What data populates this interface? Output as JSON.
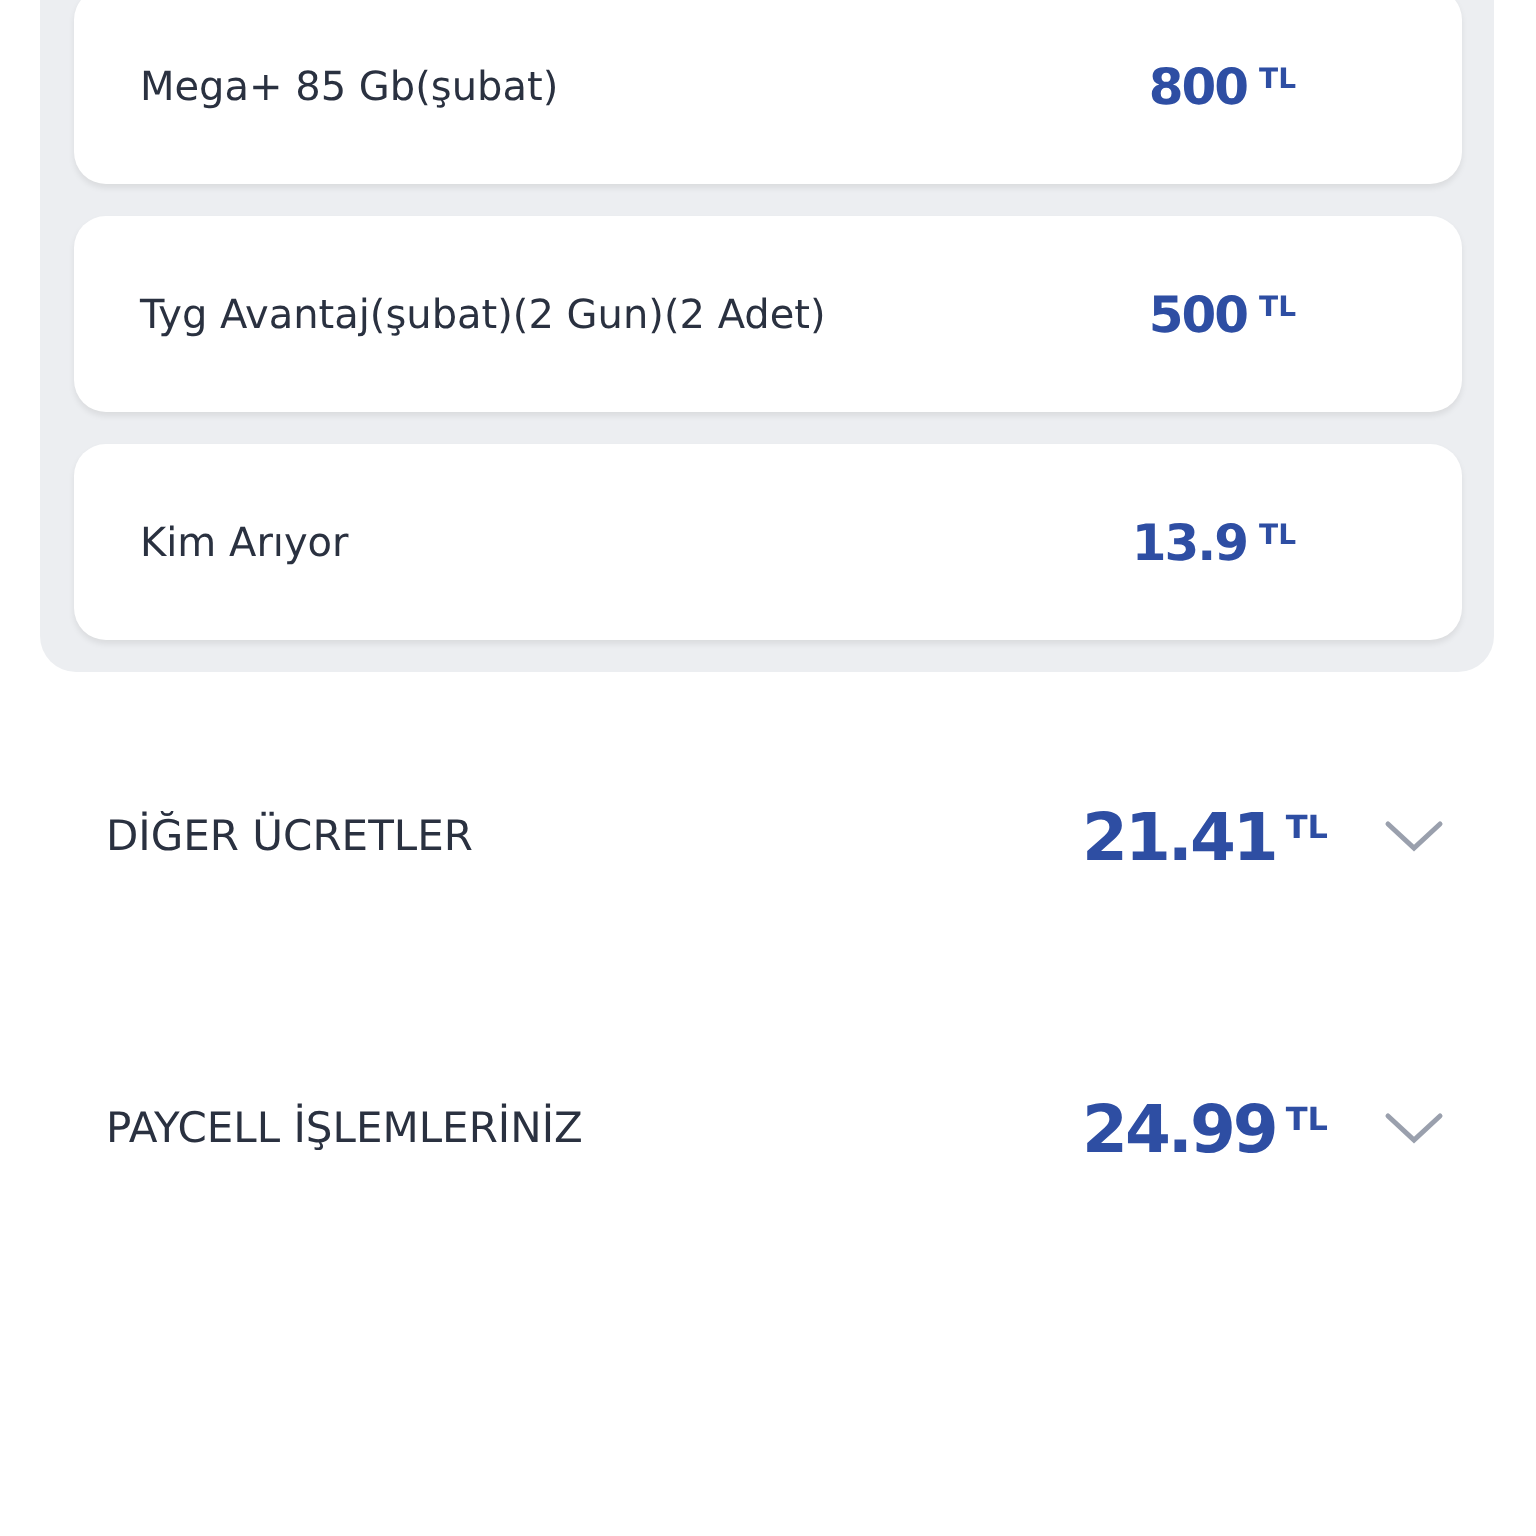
{
  "items": [
    {
      "name": "Mega+ 85 Gb(şubat)",
      "amount": "800",
      "currency": "TL"
    },
    {
      "name": "Tyg Avantaj(şubat)(2 Gun)(2 Adet)",
      "amount": "500",
      "currency": "TL"
    },
    {
      "name": "Kim Arıyor",
      "amount": "13.9",
      "currency": "TL"
    }
  ],
  "sections": [
    {
      "title": "DİĞER ÜCRETLER",
      "amount": "21.41",
      "currency": "TL",
      "expanded": false
    },
    {
      "title": "PAYCELL İŞLEMLERİNİZ",
      "amount": "24.99",
      "currency": "TL",
      "expanded": false
    }
  ]
}
